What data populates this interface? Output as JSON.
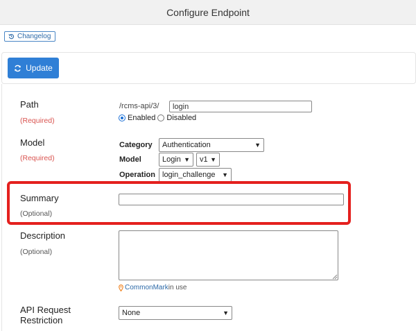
{
  "window": {
    "title": "Configure Endpoint"
  },
  "toolbar": {
    "changelog_label": "Changelog",
    "update_label": "Update"
  },
  "form": {
    "path": {
      "label": "Path",
      "requirement": "(Required)",
      "prefix": "/rcms-api/3/",
      "value": "login",
      "status_options": [
        "Enabled",
        "Disabled"
      ],
      "status_selected": "Enabled"
    },
    "model": {
      "label": "Model",
      "requirement": "(Required)",
      "category_label": "Category",
      "category_value": "Authentication",
      "model_label": "Model",
      "model_value": "Login",
      "version_value": "v1",
      "operation_label": "Operation",
      "operation_value": "login_challenge"
    },
    "summary": {
      "label": "Summary",
      "requirement": "(Optional)",
      "value": ""
    },
    "description": {
      "label": "Description",
      "requirement": "(Optional)",
      "value": "",
      "markup_link": "CommonMark",
      "markup_suffix": "in use"
    },
    "api_request_restriction": {
      "label_line1": "API Request",
      "label_line2": "Restriction",
      "value": "None"
    }
  },
  "colors": {
    "accent": "#2f7fd6",
    "highlight": "#e4201e",
    "required": "#d9534f"
  },
  "icons": {
    "changelog": "history-icon",
    "update": "refresh-icon",
    "commonmark": "map-pin-icon"
  }
}
